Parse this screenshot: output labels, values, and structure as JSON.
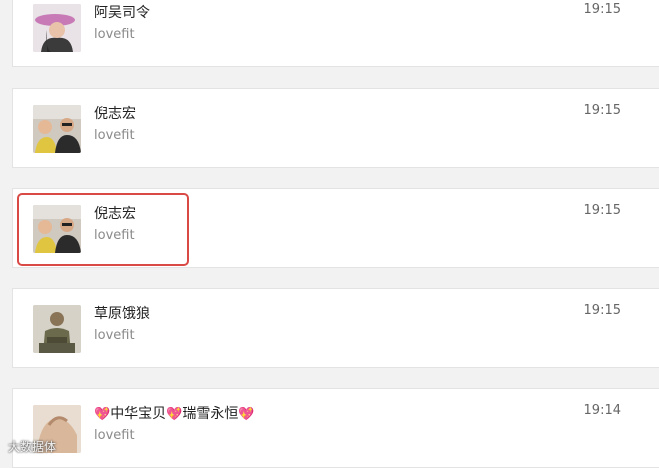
{
  "items": [
    {
      "name": "阿吴司令",
      "subtitle": "lovefit",
      "time": "19:15",
      "avatar": "woman-hat-avatar"
    },
    {
      "name": "倪志宏",
      "subtitle": "lovefit",
      "time": "19:15",
      "avatar": "father-child-avatar"
    },
    {
      "name": "倪志宏",
      "subtitle": "lovefit",
      "time": "19:15",
      "avatar": "father-child-avatar"
    },
    {
      "name": "草原饿狼",
      "subtitle": "lovefit",
      "time": "19:15",
      "avatar": "soldier-avatar"
    },
    {
      "name_parts": [
        "中华宝贝",
        "瑞雪永恒"
      ],
      "heart": "💖",
      "subtitle": "lovefit",
      "time": "19:14",
      "avatar": "hand-avatar"
    }
  ],
  "watermark": "大数据体"
}
